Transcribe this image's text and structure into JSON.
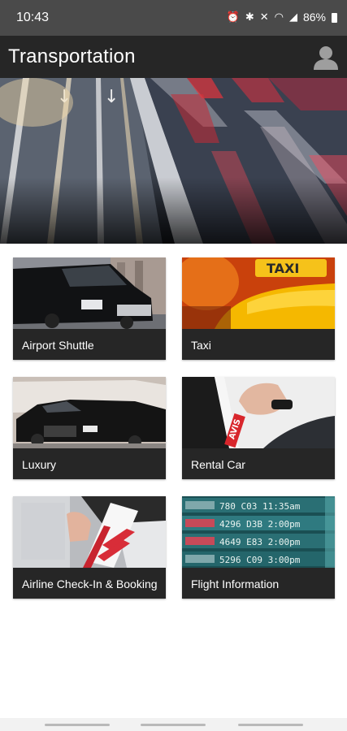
{
  "status_bar": {
    "time": "10:43",
    "battery": "86%",
    "icons": [
      "alarm-icon",
      "bluetooth-icon",
      "mute-icon",
      "wifi-icon",
      "signal-icon",
      "battery-icon"
    ]
  },
  "app_bar": {
    "title": "Transportation",
    "profile_icon": "user-icon"
  },
  "hero": {
    "subject": "highway traffic at speed"
  },
  "tiles": [
    {
      "label": "Airport Shuttle"
    },
    {
      "label": "Taxi"
    },
    {
      "label": "Luxury"
    },
    {
      "label": "Rental Car"
    },
    {
      "label": "Airline Check-In & Booking"
    },
    {
      "label": "Flight Information"
    }
  ],
  "colors": {
    "app_bar": "#262626",
    "status_bar": "#4a4a4a",
    "tile_label_bg": "#262626",
    "taxi_yellow": "#f5b800"
  }
}
